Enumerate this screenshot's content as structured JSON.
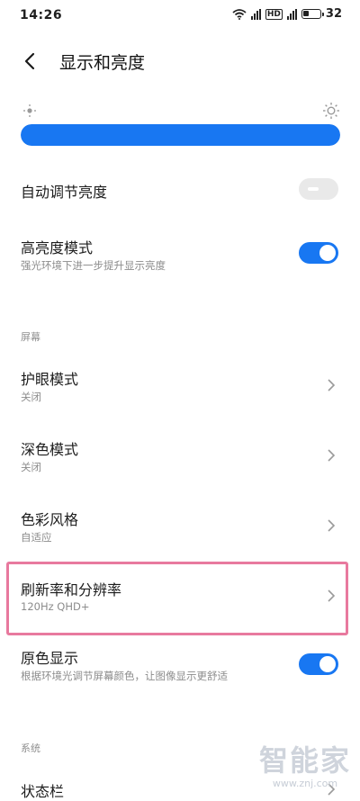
{
  "status_bar": {
    "time": "14:26",
    "network_badge": "HD",
    "battery": "32"
  },
  "header": {
    "title": "显示和亮度"
  },
  "brightness": {
    "level": 1.0,
    "accent": "#1877f2"
  },
  "items": {
    "auto_brightness": {
      "label": "自动调节亮度",
      "enabled": false
    },
    "high_brightness": {
      "label": "高亮度模式",
      "desc": "强光环境下进一步提升显示亮度",
      "enabled": true
    },
    "screen_section": "屏幕",
    "eye_care": {
      "label": "护眼模式",
      "value": "关闭"
    },
    "dark_mode": {
      "label": "深色模式",
      "value": "关闭"
    },
    "color_style": {
      "label": "色彩风格",
      "value": "自适应"
    },
    "refresh_rate": {
      "label": "刷新率和分辨率",
      "value": "120Hz  QHD+"
    },
    "true_tone": {
      "label": "原色显示",
      "desc": "根据环境光调节屏幕颜色，让图像显示更舒适",
      "enabled": true
    },
    "system_section": "系统",
    "status_bar_item": {
      "label": "状态栏"
    }
  },
  "watermark": {
    "brand": "智能家",
    "site": "www.znj.com"
  }
}
